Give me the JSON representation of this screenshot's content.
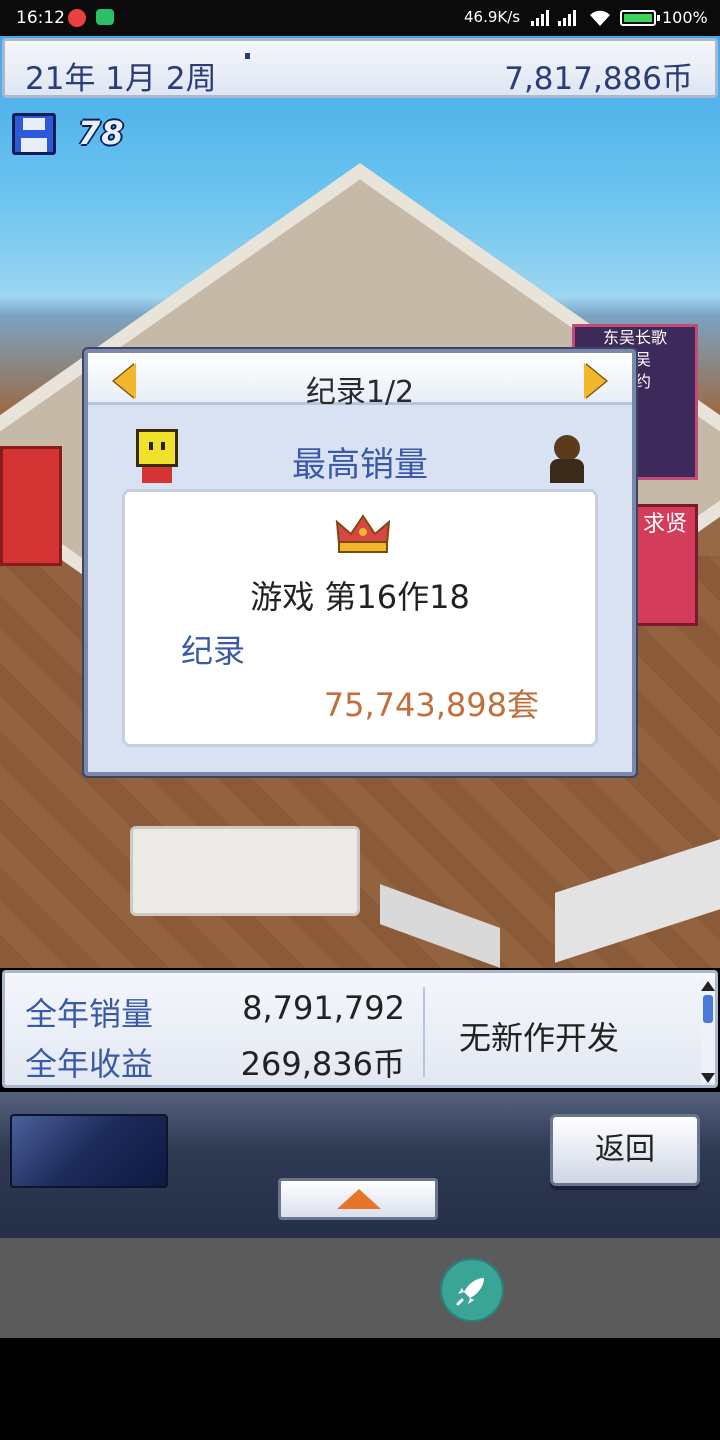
{
  "status_bar": {
    "time": "16:12",
    "network_speed": "46.9K/s",
    "battery": "100"
  },
  "top_bar": {
    "date": "21年 1月 2周",
    "money": "7,817,886币"
  },
  "save": {
    "icon": "floppy-disk-icon",
    "count": "78"
  },
  "scene": {
    "poster1_lines": [
      "东吴长歌",
      "蜀吴",
      "预约"
    ],
    "poster2_text": "求贤"
  },
  "dialog": {
    "title": "纪录1/2",
    "subtitle": "最高销量",
    "game_title": "游戏 第16作18",
    "record_label": "纪录",
    "record_value": "75,743,898套"
  },
  "stats": {
    "annual_sales_label": "全年销量",
    "annual_sales_value": "8,791,792",
    "annual_revenue_label": "全年收益",
    "annual_revenue_value": "269,836币",
    "dev_status": "无新作开发"
  },
  "controls": {
    "back_label": "返回"
  },
  "colors": {
    "accent_blue": "#3a5aa8",
    "record_orange": "#c0703c",
    "arrow_gold": "#f0b72b"
  }
}
